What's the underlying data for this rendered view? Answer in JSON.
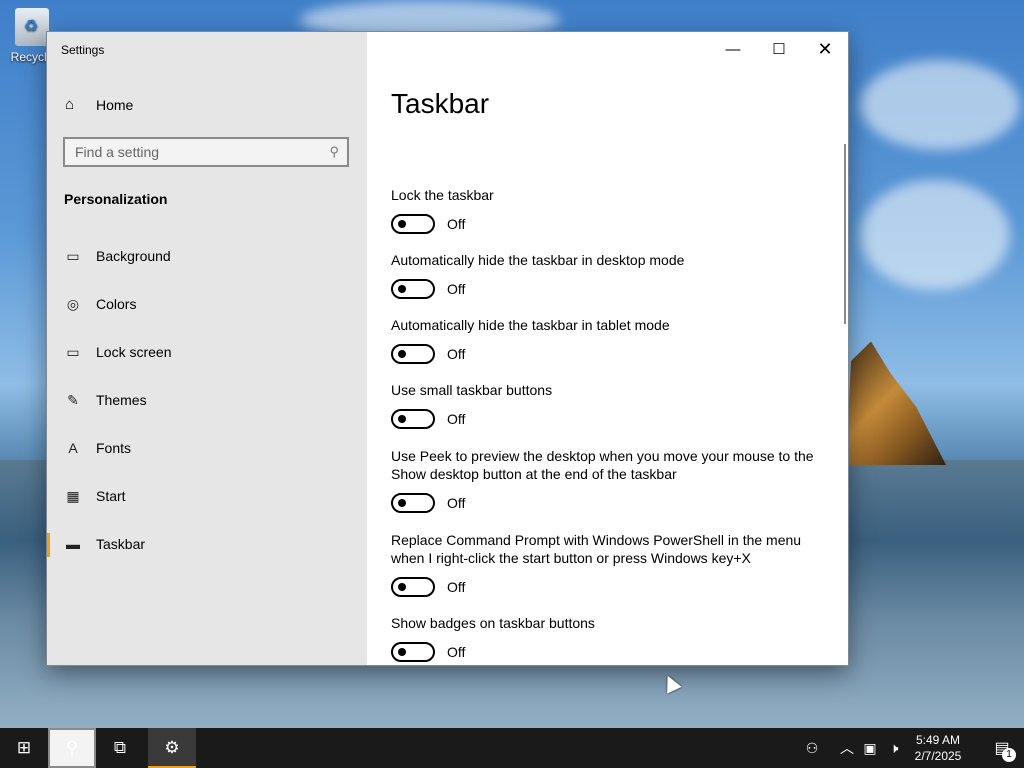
{
  "desktop": {
    "recycle_bin_label": "Recycle"
  },
  "window": {
    "title": "Settings",
    "minimize_icon": "minimize-icon",
    "maximize_icon": "maximize-icon",
    "close_icon": "close-icon"
  },
  "sidebar": {
    "home_label": "Home",
    "search_placeholder": "Find a setting",
    "section_title": "Personalization",
    "items": [
      {
        "label": "Background",
        "icon": "picture-icon"
      },
      {
        "label": "Colors",
        "icon": "palette-icon"
      },
      {
        "label": "Lock screen",
        "icon": "lock-screen-icon"
      },
      {
        "label": "Themes",
        "icon": "themes-icon"
      },
      {
        "label": "Fonts",
        "icon": "fonts-icon"
      },
      {
        "label": "Start",
        "icon": "start-icon"
      },
      {
        "label": "Taskbar",
        "icon": "taskbar-icon",
        "active": true
      }
    ]
  },
  "main": {
    "title": "Taskbar",
    "settings": [
      {
        "label": "Lock the taskbar",
        "state": "Off"
      },
      {
        "label": "Automatically hide the taskbar in desktop mode",
        "state": "Off"
      },
      {
        "label": "Automatically hide the taskbar in tablet mode",
        "state": "Off"
      },
      {
        "label": "Use small taskbar buttons",
        "state": "Off"
      },
      {
        "label": "Use Peek to preview the desktop when you move your mouse to the Show desktop button at the end of the taskbar",
        "state": "Off"
      },
      {
        "label": "Replace Command Prompt with Windows PowerShell in the menu when I right-click the start button or press Windows key+X",
        "state": "Off"
      },
      {
        "label": "Show badges on taskbar buttons",
        "state": "Off"
      }
    ]
  },
  "taskbar": {
    "time": "5:49 AM",
    "date": "2/7/2025",
    "notification_count": "1",
    "accent_color": "#e8a020"
  }
}
